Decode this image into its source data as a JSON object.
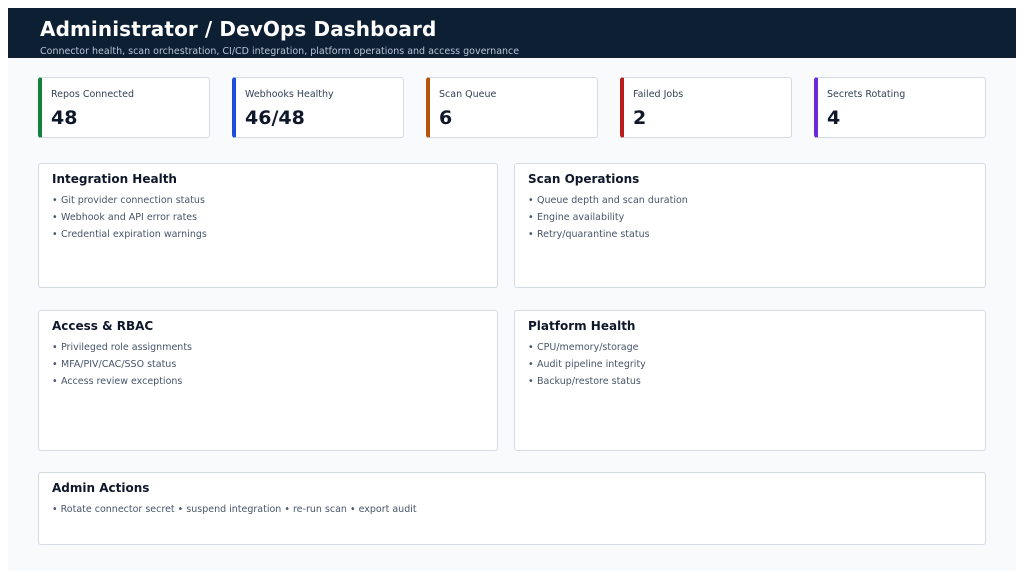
{
  "header": {
    "title": "Administrator / DevOps Dashboard",
    "subtitle": "Connector health, scan orchestration, CI/CD integration, platform operations and access governance"
  },
  "kpis": [
    {
      "label": "Repos Connected",
      "value": "48",
      "color": "#15803d"
    },
    {
      "label": "Webhooks Healthy",
      "value": "46/48",
      "color": "#1d4ed8"
    },
    {
      "label": "Scan Queue",
      "value": "6",
      "color": "#b45309"
    },
    {
      "label": "Failed Jobs",
      "value": "2",
      "color": "#b91c1c"
    },
    {
      "label": "Secrets Rotating",
      "value": "4",
      "color": "#6d28d9"
    }
  ],
  "panels": {
    "integration_health": {
      "title": "Integration Health",
      "items": [
        "Git provider connection status",
        "Webhook and API error rates",
        "Credential expiration warnings"
      ]
    },
    "scan_operations": {
      "title": "Scan Operations",
      "items": [
        "Queue depth and scan duration",
        "Engine availability",
        "Retry/quarantine status"
      ]
    },
    "access_rbac": {
      "title": "Access & RBAC",
      "items": [
        "Privileged role assignments",
        "MFA/PIV/CAC/SSO status",
        "Access review exceptions"
      ]
    },
    "platform_health": {
      "title": "Platform Health",
      "items": [
        "CPU/memory/storage",
        "Audit pipeline integrity",
        "Backup/restore status"
      ]
    },
    "admin_actions": {
      "title": "Admin Actions",
      "text": "• Rotate connector secret • suspend integration • re-run scan • export audit"
    }
  },
  "bullet": "•"
}
